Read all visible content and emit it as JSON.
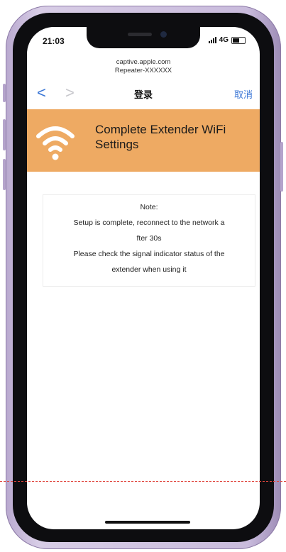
{
  "status_bar": {
    "time": "21:03",
    "network": "4G"
  },
  "browser": {
    "url": "captive.apple.com",
    "subtitle": "Repeater-XXXXXX",
    "back_glyph": "<",
    "forward_glyph": ">",
    "title": "登录",
    "cancel_label": "取消"
  },
  "header": {
    "title": "Complete Extender WiFi Settings",
    "icon": "wifi-icon",
    "color": "#eeaa63"
  },
  "note": {
    "heading": "Note:",
    "lines": [
      "Setup is complete, reconnect to the network a",
      "fter 30s",
      "Please check the signal indicator status of the",
      "extender when using it"
    ]
  },
  "colors": {
    "accent": "#3a76d6",
    "frame": "#c9bbdc",
    "cut_line": "#e0443c"
  }
}
